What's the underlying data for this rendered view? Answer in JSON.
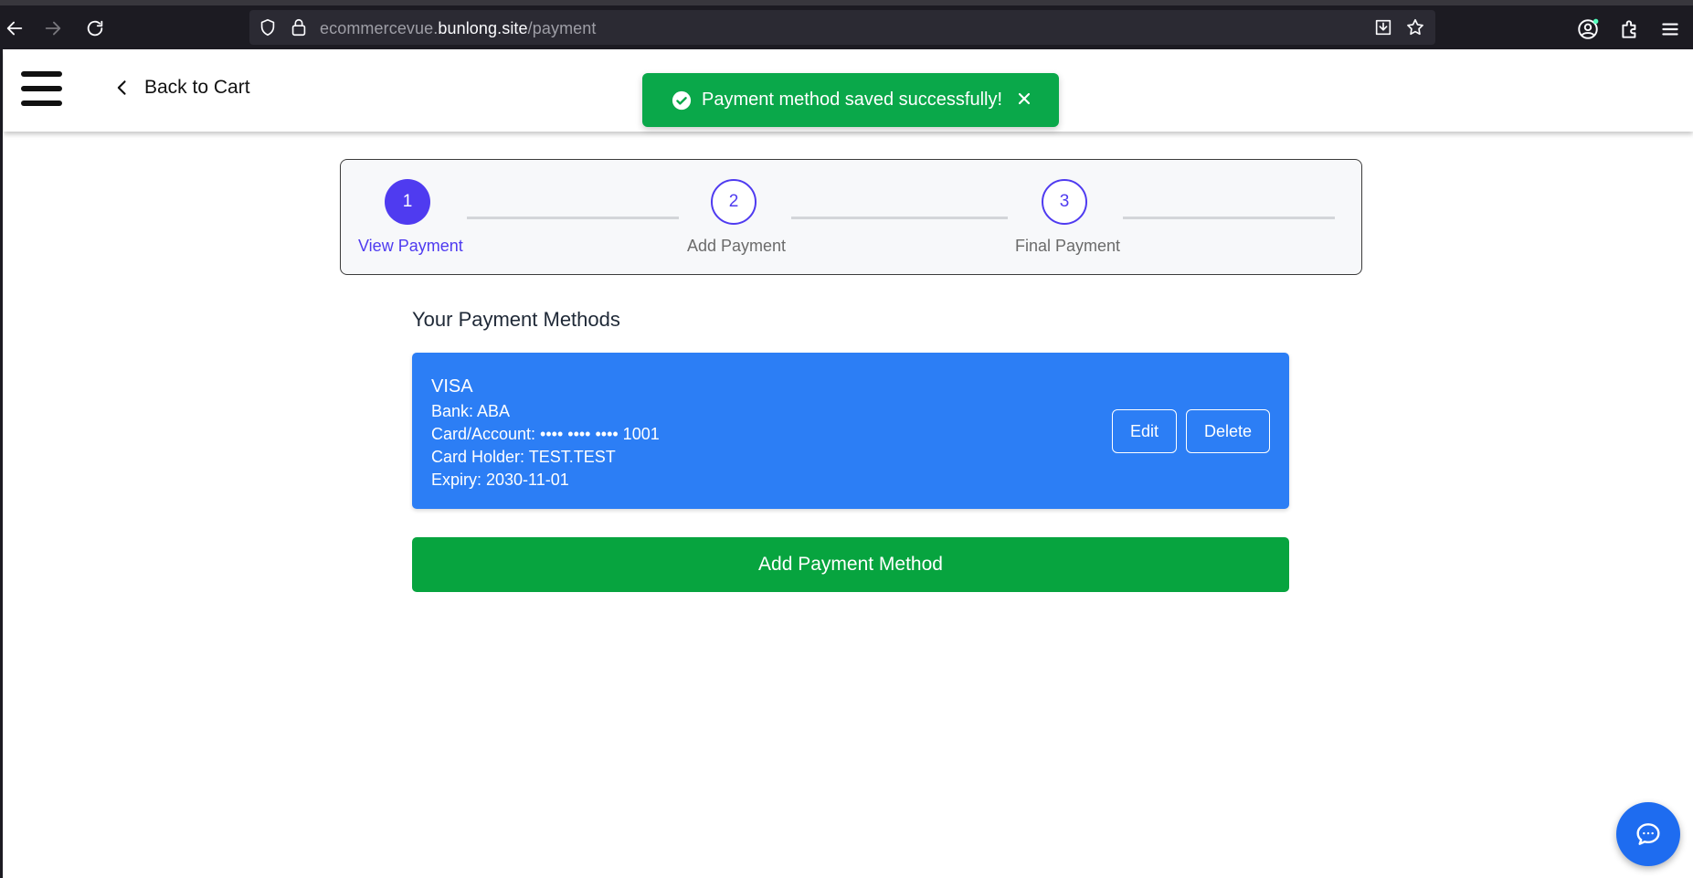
{
  "browser": {
    "url_prefix": "ecommercevue.",
    "url_domain": "bunlong.site",
    "url_path": "/payment"
  },
  "header": {
    "back_label": "Back to Cart"
  },
  "toast": {
    "message": "Payment method saved successfully!",
    "color": "#0aa84a"
  },
  "stepper": {
    "steps": [
      {
        "number": "1",
        "label": "View Payment",
        "state": "active"
      },
      {
        "number": "2",
        "label": "Add Payment",
        "state": "idle"
      },
      {
        "number": "3",
        "label": "Final Payment",
        "state": "idle"
      }
    ],
    "accent": "#4f3bf0"
  },
  "payment_methods": {
    "title": "Your Payment Methods",
    "cards": [
      {
        "brand": "VISA",
        "bank": "Bank: ABA",
        "account": "Card/Account: •••• •••• •••• 1001",
        "holder": "Card Holder: TEST.TEST",
        "expiry": "Expiry: 2030-11-01",
        "edit_label": "Edit",
        "delete_label": "Delete",
        "color": "#2c7ef5"
      }
    ],
    "add_label": "Add Payment Method",
    "add_color": "#07a43f"
  },
  "chat": {
    "icon": "chat-bubble-icon",
    "color": "#1e6cf0"
  }
}
